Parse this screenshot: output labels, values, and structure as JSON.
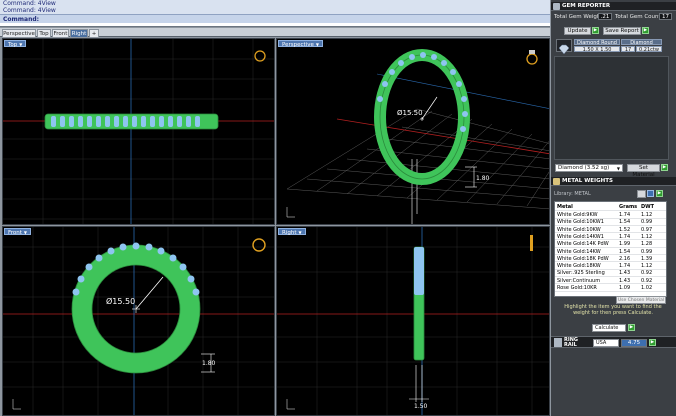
{
  "command": {
    "line1": "Command: 4View",
    "line2": "Command: 4View",
    "prompt": "Command:"
  },
  "viewport_tabs": [
    "Perspective",
    "Top",
    "Front",
    "Right"
  ],
  "viewports": {
    "top": {
      "label": "Top"
    },
    "perspective": {
      "label": "Perspective",
      "diameter": "Ø15.50",
      "height": "1.80"
    },
    "front": {
      "label": "Front",
      "diameter": "Ø15.50",
      "height": "1.80"
    },
    "right": {
      "label": "Right",
      "width": "1.50"
    }
  },
  "gem_reporter": {
    "title": "GEM REPORTER",
    "total_weight_label": "Total Gem Weight",
    "total_weight_value": ".21",
    "total_count_label": "Total Gem Count",
    "total_count_value": "17",
    "update_label": "Update",
    "save_report_label": "Save Report",
    "gem_table": {
      "headers": [
        "Diamond Round",
        "Diamond"
      ],
      "size": "1.50 X 1.50",
      "count": "17",
      "weight": "0.21ctw"
    },
    "material_select": "Diamond  (3.52 sg)",
    "set_material_label": "Set Material"
  },
  "metal_weights": {
    "title": "METAL WEIGHTS",
    "library_label": "Library",
    "library_value": "METAL",
    "columns": [
      "Metal",
      "Grams",
      "DWT"
    ],
    "rows": [
      [
        "White Gold:9KW",
        "1.74",
        "1.12"
      ],
      [
        "White Gold:10KW1",
        "1.54",
        "0.99"
      ],
      [
        "White Gold:10KW",
        "1.52",
        "0.97"
      ],
      [
        "White Gold:14KW1",
        "1.74",
        "1.12"
      ],
      [
        "White Gold:14K PdW",
        "1.99",
        "1.28"
      ],
      [
        "White Gold:14KW",
        "1.54",
        "0.99"
      ],
      [
        "White Gold:18K PdW",
        "2.16",
        "1.39"
      ],
      [
        "White Gold:18KW",
        "1.74",
        "1.12"
      ],
      [
        "Silver:.925 Sterling",
        "1.43",
        "0.92"
      ],
      [
        "Silver:Continuum",
        "1.43",
        "0.92"
      ],
      [
        "Rose Gold:10KR",
        "1.09",
        "1.02"
      ]
    ],
    "hint": "Highlight the item you want to find the weight for then press Calculate.",
    "calculate_label": "Calculate"
  },
  "ring_size": {
    "label_top": "RING",
    "label_bottom": "RAIL",
    "standard": "USA",
    "value": "4.75"
  },
  "colors": {
    "ring_green": "#3fc45a",
    "gem_blue": "#8ec5f0",
    "viewport_bg": "#000000",
    "panel_bg": "#3b3f44",
    "tab_active": "#4a6fa0"
  }
}
